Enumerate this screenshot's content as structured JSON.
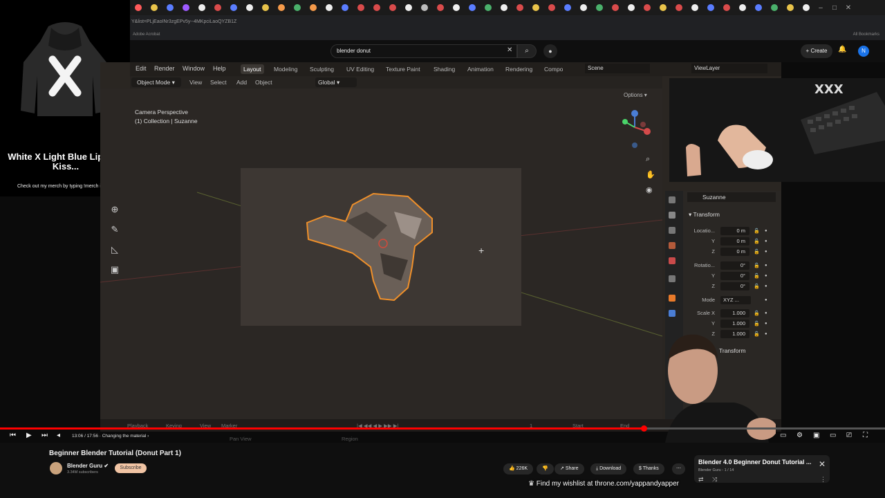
{
  "browser": {
    "url_fragment": "Y&list=PLjEaoINr3zgEPv5y--4MKpciLaoQYZB1Z",
    "bookmark_left": "Adobe Acrobat",
    "bookmark_right": "All Bookmarks"
  },
  "youtube": {
    "search_value": "blender donut",
    "create_label": "Create",
    "avatar_letter": "N"
  },
  "merch": {
    "title": "White X Light Blue Lipstick Kiss...",
    "subtitle": "Check out my merch by typing !merch in chat"
  },
  "blender": {
    "menus": [
      "Edit",
      "Render",
      "Window",
      "Help"
    ],
    "workspaces": [
      "Layout",
      "Modeling",
      "Sculpting",
      "UV Editing",
      "Texture Paint",
      "Shading",
      "Animation",
      "Rendering",
      "Compo"
    ],
    "scene": "Scene",
    "view_layer": "ViewLayer",
    "mode": "Object Mode",
    "header_items": [
      "View",
      "Select",
      "Add",
      "Object"
    ],
    "orientation": "Global",
    "options": "Options",
    "camera_line1": "Camera Perspective",
    "camera_line2": "(1) Collection | Suzanne",
    "object_name": "Suzanne",
    "transform_title": "Transform",
    "location_label": "Locatio...",
    "rotation_label": "Rotatio...",
    "mode_label": "Mode",
    "mode_value": "XYZ ...",
    "scale_label": "Scale X",
    "axis_y": "Y",
    "axis_z": "Z",
    "loc_x": "0 m",
    "loc_y": "0 m",
    "loc_z": "0 m",
    "rot_x": "0°",
    "rot_y": "0°",
    "rot_z": "0°",
    "scale_x": "1.000",
    "scale_y": "1.000",
    "scale_z": "1.000",
    "delta_transform": "Transform",
    "timeline": {
      "playback": "Playback",
      "keying": "Keying",
      "view": "View",
      "marker": "Marker",
      "frame": "1",
      "start": "Start",
      "end": "End",
      "pan_view": "Pan View",
      "region": "Region"
    }
  },
  "player": {
    "time": "13:06 / 17:56",
    "chapter": "Changing the material",
    "progress": 0.727
  },
  "video": {
    "title": "Beginner Blender Tutorial (Donut Part 1)",
    "channel": "Blender Guru",
    "subscribers": "3.34M subscribers",
    "subscribe_label": "Subscribe",
    "likes": "226K",
    "share": "Share",
    "download": "Download",
    "thanks": "Thanks"
  },
  "playlist": {
    "title": "Blender 4.0 Beginner Donut Tutorial ...",
    "subtitle": "Blender Guru - 1 / 14"
  },
  "overlay": {
    "wishlist": "Find my wishlist at throne.com/yappandyapper"
  }
}
